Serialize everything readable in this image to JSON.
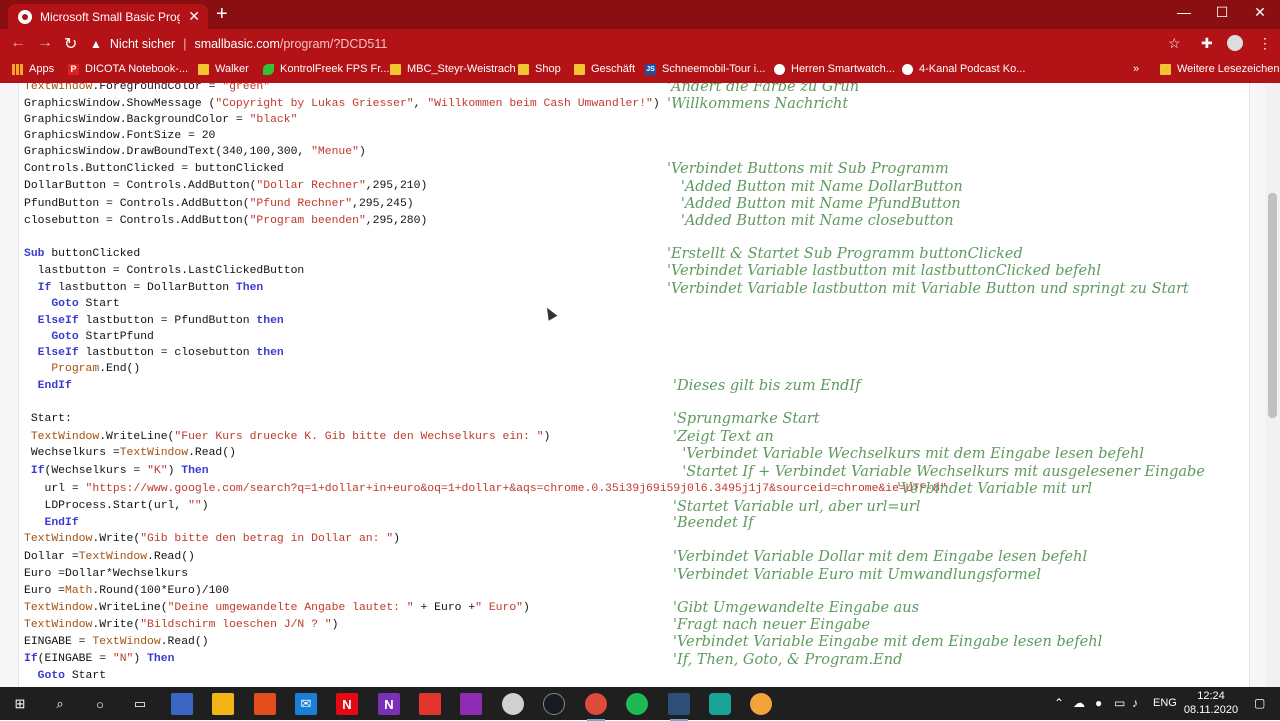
{
  "browser": {
    "tab_title": "Microsoft Small Basic Program Li",
    "tab_close": "✕",
    "new_tab": "+",
    "security_label": "Nicht sicher",
    "url_host": "smallbasic.com",
    "url_path": "/program/?DCD511",
    "window_controls": [
      "—",
      "☐",
      "✕"
    ]
  },
  "bookmarks": [
    {
      "icon": "apps-grid-icon",
      "label": "Apps"
    },
    {
      "icon": "p-favicon",
      "label": "DICOTA Notebook-..."
    },
    {
      "icon": "folder-icon",
      "label": "Walker"
    },
    {
      "icon": "leaf-favicon",
      "label": "KontrolFreek FPS Fr..."
    },
    {
      "icon": "folder-icon",
      "label": "MBC_Steyr-Weistrach"
    },
    {
      "icon": "folder-icon",
      "label": "Shop"
    },
    {
      "icon": "folder-icon",
      "label": "Geschäft"
    },
    {
      "icon": "js-favicon",
      "label": "Schneemobil-Tour i..."
    },
    {
      "icon": "circle-favicon",
      "label": "Herren Smartwatch..."
    },
    {
      "icon": "circle-favicon",
      "label": "4-Kanal Podcast Ko..."
    },
    {
      "icon": "folder-icon",
      "label": "Weitere Lesezeichen"
    }
  ],
  "bookmarks_overflow": "»",
  "code_lines": [
    "TextWindow.ForegroundColor = \"green\"",
    "GraphicsWindow.ShowMessage (\"Copyright by Lukas Griesser\", \"Willkommen beim Cash Umwandler!\")",
    "GraphicsWindow.BackgroundColor = \"black\"",
    "GraphicsWindow.FontSize = 20",
    "GraphicsWindow.DrawBoundText(340,100,300, \"Menue\")",
    "Controls.ButtonClicked = buttonClicked",
    "DollarButton = Controls.AddButton(\"Dollar Rechner\",295,210)",
    "PfundButton = Controls.AddButton(\"Pfund Rechner\",295,245)",
    "closebutton = Controls.AddButton(\"Program beenden\",295,280)",
    "Sub buttonClicked",
    "  lastbutton = Controls.LastClickedButton",
    "  If lastbutton = DollarButton Then",
    "    Goto Start",
    "  ElseIf lastbutton = PfundButton then",
    "    Goto StartPfund",
    "  ElseIf lastbutton = closebutton then",
    "    Program.End()",
    "  EndIf",
    " Start:",
    " TextWindow.WriteLine(\"Fuer Kurs druecke K. Gib bitte den Wechselkurs ein: \")",
    " Wechselkurs =TextWindow.Read()",
    " If(Wechselkurs = \"K\") Then",
    "   url = \"https://www.google.com/search?q=1+dollar+in+euro&oq=1+dollar+&aqs=chrome.0.35i39j69i59j0l6.3495j1j7&sourceid=chrome&ie=UTF-8\"",
    "   LDProcess.Start(url, \"\")",
    "   EndIf",
    "TextWindow.Write(\"Gib bitte den betrag in Dollar an: \")",
    "Dollar =TextWindow.Read()",
    "Euro =Dollar*Wechselkurs",
    "Euro =Math.Round(100*Euro)/100",
    "TextWindow.WriteLine(\"Deine umgewandelte Angabe lautet: \" + Euro +\" Euro\")",
    "TextWindow.Write(\"Bildschirm loeschen J/N ? \")",
    "EINGABE = TextWindow.Read()",
    "If(EINGABE = \"N\") Then",
    "  Goto Start"
  ],
  "comments": [
    "'Ändert die Farbe zu Grün",
    "'Willkommens Nachricht",
    "'Verbindet Buttons mit Sub Programm",
    "   'Added Button mit Name DollarButton",
    "   'Added Button mit Name PfundButton",
    "   'Added Button mit Name closebutton",
    "'Erstellt & Startet Sub Programm buttonClicked",
    "'Verbindet Variable lastbutton mit lastbuttonClicked befehl",
    "'Verbindet Variable lastbutton mit Variable Button und springt zu Start",
    "'Dieses gilt bis zum EndIf",
    "'Sprungmarke Start",
    "'Zeigt Text an",
    "  'Verbindet Variable Wechselkurs mit dem Eingabe lesen befehl",
    "  'Startet If + Verbindet Variable Wechselkurs mit ausgelesener Eingabe",
    "'Verbindet Variable mit url",
    "'Startet Variable url, aber url=url",
    "'Beendet If",
    "'Verbindet Variable Dollar mit dem Eingabe lesen befehl",
    "'Verbindet Variable Euro mit Umwandlungsformel",
    "'Gibt Umgewandelte Eingabe aus",
    "'Fragt nach neuer Eingabe",
    "'Verbindet Variable Eingabe mit dem Eingabe lesen befehl",
    "'If, Then, Goto, & Program.End"
  ],
  "taskbar": {
    "lang": "ENG",
    "time": "12:24",
    "date": "08.11.2020"
  }
}
